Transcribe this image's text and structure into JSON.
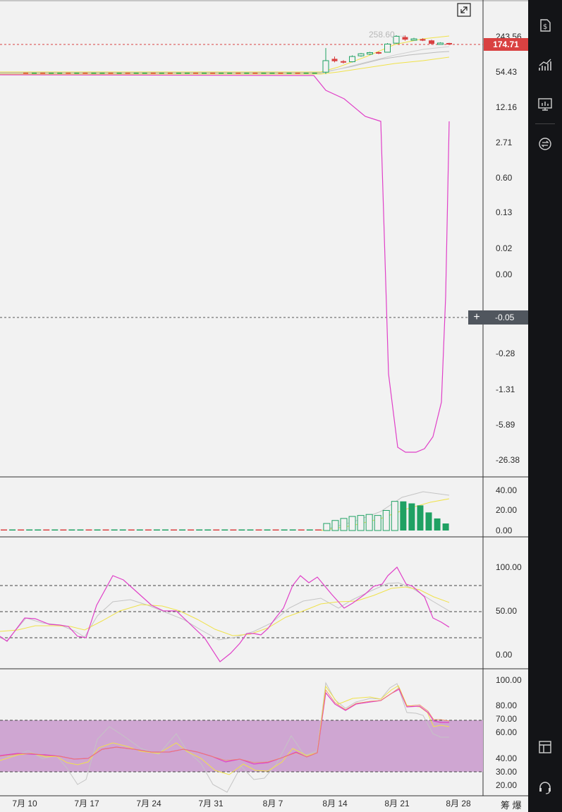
{
  "chart_data": [
    {
      "panel": "price",
      "type": "candlestick",
      "scale": "log",
      "y_tick_labels": [
        "243.56",
        "54.43",
        "12.16",
        "2.71",
        "0.60",
        "0.13",
        "0.02",
        "0.00",
        "-0.05",
        "-0.28",
        "-1.31",
        "-5.89",
        "-26.38"
      ],
      "last_price_label": "174.71",
      "high_marker_label": "258.60",
      "crosshair_label": "-0.05",
      "x_tick_labels": [
        "7月 10",
        "7月 17",
        "7月 24",
        "7月 31",
        "8月 7",
        "8月 14",
        "8月 21",
        "8月 28"
      ],
      "candles": [
        {
          "date": "8月 13",
          "open": 54,
          "close": 88,
          "high": 150,
          "low": 50,
          "dir": "up"
        },
        {
          "date": "8月 14",
          "open": 95,
          "close": 86,
          "high": 105,
          "low": 82,
          "dir": "down"
        },
        {
          "date": "8月 15",
          "open": 86,
          "close": 81,
          "high": 90,
          "low": 78,
          "dir": "down"
        },
        {
          "date": "8月 16",
          "open": 84,
          "close": 105,
          "high": 110,
          "low": 82,
          "dir": "up"
        },
        {
          "date": "8月 17",
          "open": 108,
          "close": 118,
          "high": 122,
          "low": 104,
          "dir": "up"
        },
        {
          "date": "8月 18",
          "open": 116,
          "close": 124,
          "high": 128,
          "low": 112,
          "dir": "up"
        },
        {
          "date": "8月 19",
          "open": 126,
          "close": 120,
          "high": 130,
          "low": 116,
          "dir": "down"
        },
        {
          "date": "8月 20",
          "open": 126,
          "close": 178,
          "high": 185,
          "low": 124,
          "dir": "up"
        },
        {
          "date": "8月 21",
          "open": 185,
          "close": 248,
          "high": 258.6,
          "low": 180,
          "dir": "up"
        },
        {
          "date": "8月 22",
          "open": 240,
          "close": 215,
          "high": 258,
          "low": 205,
          "dir": "down"
        },
        {
          "date": "8月 23",
          "open": 218,
          "close": 222,
          "high": 232,
          "low": 210,
          "dir": "up"
        },
        {
          "date": "8月 24",
          "open": 220,
          "close": 206,
          "high": 228,
          "low": 202,
          "dir": "down"
        },
        {
          "date": "8月 25",
          "open": 208,
          "close": 180,
          "high": 214,
          "low": 174,
          "dir": "down"
        },
        {
          "date": "8月 26",
          "open": 180,
          "close": 186,
          "high": 192,
          "low": 176,
          "dir": "up"
        },
        {
          "date": "8月 27",
          "open": 186,
          "close": 174.71,
          "high": 188,
          "low": 172,
          "dir": "down"
        }
      ],
      "colors": {
        "up": "#1fa163",
        "down": "#d94141",
        "ma_yellow": "#f0e24a",
        "ma_gray": "#b8b8b8",
        "indicator": "#e040c8",
        "grid_dash": "#d94141"
      }
    },
    {
      "panel": "volume",
      "type": "bar",
      "y_tick_labels": [
        "40.00",
        "20.00",
        "0.00"
      ],
      "ylim": [
        0,
        48
      ],
      "values": [
        1,
        1,
        1,
        1,
        1,
        1,
        1,
        1,
        1,
        1,
        1,
        1,
        1,
        1,
        1,
        1,
        1,
        1,
        1,
        1,
        1,
        1,
        1,
        1,
        1,
        1,
        1,
        1,
        1,
        1,
        1,
        1,
        1,
        1,
        1,
        1,
        1,
        1,
        7,
        10,
        12,
        14,
        15,
        16,
        15,
        20,
        29,
        29,
        27,
        25,
        18,
        12,
        7
      ],
      "up_flags": [
        0,
        1,
        0,
        1,
        1,
        0,
        1,
        0,
        1,
        1,
        0,
        1,
        0,
        1,
        1,
        0,
        1,
        0,
        1,
        1,
        0,
        1,
        0,
        1,
        1,
        0,
        1,
        0,
        1,
        1,
        0,
        1,
        0,
        1,
        1,
        0,
        1,
        0,
        1,
        1,
        1,
        1,
        1,
        1,
        1,
        1,
        1,
        0,
        0,
        0,
        0,
        0,
        0
      ]
    },
    {
      "panel": "oscillator",
      "type": "line",
      "y_tick_labels": [
        "100.00",
        "50.00",
        "0.00"
      ],
      "ylim": [
        -12,
        115
      ],
      "levels": [
        80,
        50,
        20
      ]
    },
    {
      "panel": "rsi",
      "type": "line",
      "y_tick_labels": [
        "100.00",
        "80.00",
        "70.00",
        "60.00",
        "40.00",
        "30.00",
        "20.00"
      ],
      "ylim": [
        13,
        107
      ],
      "band": [
        30,
        70
      ],
      "band_color": "#cfa6d2"
    }
  ],
  "footer": {
    "text": "筹 爆"
  },
  "sidebar": {
    "icons": [
      "dollar-doc-icon",
      "chart-up-icon",
      "monitor-chart-icon",
      "swap-icon",
      "layout-icon",
      "headset-icon"
    ]
  }
}
